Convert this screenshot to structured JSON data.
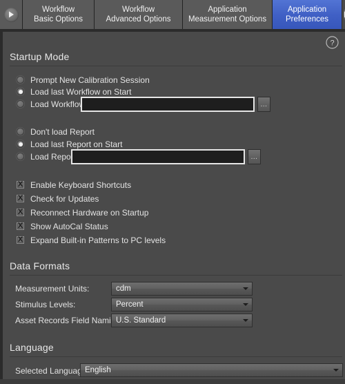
{
  "window": {
    "accent_color": "#3f5fc4",
    "panel_bg": "#4a4a4a",
    "tab_bg": "#5a5a5a"
  },
  "tabbar": {
    "nav_prev_icon": "triangle-right-icon",
    "nav_next_icon": "triangle-right-icon",
    "tabs": [
      {
        "line1": "Workflow",
        "line2": "Basic Options",
        "active": false
      },
      {
        "line1": "Workflow",
        "line2": "Advanced Options",
        "active": false
      },
      {
        "line1": "Application",
        "line2": "Measurement Options",
        "active": false
      },
      {
        "line1": "Application",
        "line2": "Preferences",
        "active": true
      }
    ]
  },
  "help": {
    "icon": "question-mark-circle-icon",
    "label": "?"
  },
  "sections": {
    "startup": {
      "title": "Startup Mode",
      "workflow_radios": [
        {
          "label": "Prompt New Calibration Session",
          "checked": false
        },
        {
          "label": "Load last Workflow on Start",
          "checked": true
        },
        {
          "label": "Load Workflow:",
          "checked": false
        }
      ],
      "workflow_input": {
        "value": "",
        "placeholder": ""
      },
      "workflow_browse": "...",
      "report_radios": [
        {
          "label": "Don't load Report",
          "checked": false
        },
        {
          "label": "Load last Report on Start",
          "checked": true
        },
        {
          "label": "Load Report:",
          "checked": false
        }
      ],
      "report_input": {
        "value": "",
        "placeholder": ""
      },
      "report_browse": "...",
      "checkboxes": [
        {
          "label": "Enable Keyboard Shortcuts",
          "checked": true
        },
        {
          "label": "Check for Updates",
          "checked": true
        },
        {
          "label": "Reconnect Hardware on Startup",
          "checked": true
        },
        {
          "label": "Show AutoCal Status",
          "checked": true
        },
        {
          "label": "Expand Built-in Patterns to PC levels",
          "checked": true
        }
      ],
      "check_glyph": "X"
    },
    "data_formats": {
      "title": "Data Formats",
      "fields": [
        {
          "label": "Measurement Units:",
          "value": "cdm"
        },
        {
          "label": "Stimulus Levels:",
          "value": "Percent"
        },
        {
          "label": "Asset Records Field Naming:",
          "value": "U.S. Standard"
        }
      ]
    },
    "language": {
      "title": "Language",
      "field": {
        "label": "Selected Language",
        "value": "English"
      }
    }
  }
}
